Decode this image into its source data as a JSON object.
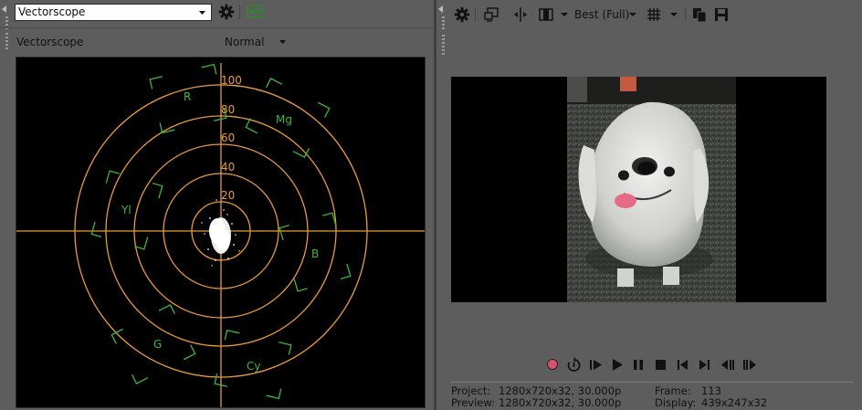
{
  "scope_panel": {
    "scope_selector": "Vectorscope",
    "scope_title": "Vectorscope",
    "mode_selector": "Normal",
    "rings": [
      "20",
      "40",
      "60",
      "80",
      "100"
    ],
    "targets": [
      "R",
      "Mg",
      "Yl",
      "B",
      "G",
      "Cy"
    ],
    "colors": {
      "graticule": "#e89b3b",
      "targets": "#3db83a",
      "trace": "#ffffff"
    }
  },
  "preview_panel": {
    "toolbar": {
      "quality": "Best (Full)"
    },
    "info": {
      "project_label": "Project:",
      "project_value": "1280x720x32, 30.000p",
      "preview_label": "Preview:",
      "preview_value": "1280x720x32, 30.000p",
      "frame_label": "Frame:",
      "frame_value": "113",
      "display_label": "Display:",
      "display_value": "439x247x32"
    },
    "transport_colors": {
      "record": "#d9536b",
      "controls": "#111111"
    }
  }
}
